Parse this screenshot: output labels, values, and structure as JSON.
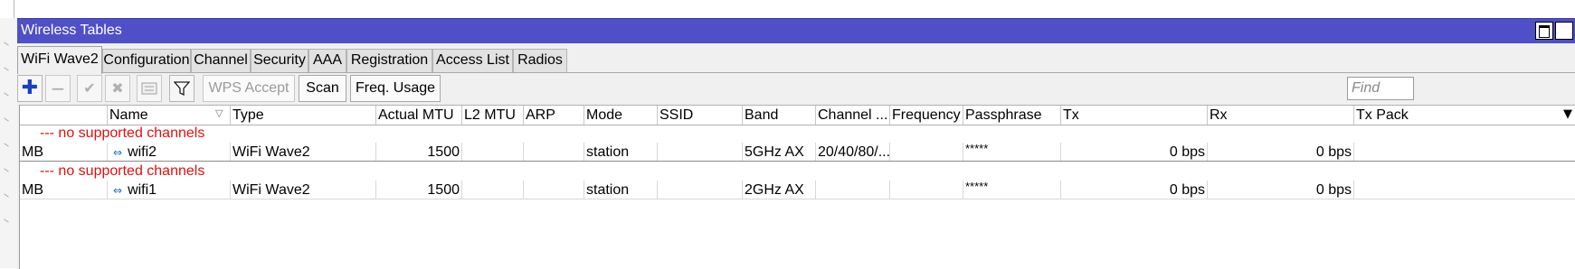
{
  "window": {
    "title": "Wireless Tables",
    "maximize_icon": "maximize-icon",
    "close_icon": "close-icon",
    "close_glyph": "✕"
  },
  "tabs": [
    "WiFi Wave2",
    "Configuration",
    "Channel",
    "Security",
    "AAA",
    "Registration",
    "Access List",
    "Radios"
  ],
  "active_tab": "WiFi Wave2",
  "toolbar": {
    "icons": [
      "add-icon",
      "remove-icon",
      "enable-icon",
      "disable-icon",
      "comment-icon",
      "filter-icon"
    ],
    "wps_accept": "WPS Accept",
    "scan": "Scan",
    "freq_usage": "Freq. Usage",
    "find_placeholder": "Find"
  },
  "table": {
    "columns": [
      "",
      "Name",
      "Type",
      "Actual MTU",
      "L2 MTU",
      "ARP",
      "Mode",
      "SSID",
      "Band",
      "Channel ...",
      "Frequency",
      "Passphrase",
      "Tx",
      "Rx",
      "Tx Pack"
    ],
    "groups": [
      {
        "comment": "--- no supported channels",
        "row": {
          "flags": "MB",
          "name": "wifi2",
          "type": "WiFi Wave2",
          "actual_mtu": "1500",
          "l2_mtu": "",
          "arp": "",
          "mode": "station",
          "ssid": "",
          "band": "5GHz AX",
          "channel": "20/40/80/...",
          "frequency": "",
          "passphrase": "*****",
          "tx": "0 bps",
          "rx": "0 bps",
          "tx_pack": ""
        }
      },
      {
        "comment": "--- no supported channels",
        "row": {
          "flags": "MB",
          "name": "wifi1",
          "type": "WiFi Wave2",
          "actual_mtu": "1500",
          "l2_mtu": "",
          "arp": "",
          "mode": "station",
          "ssid": "",
          "band": "2GHz AX",
          "channel": "",
          "frequency": "",
          "passphrase": "*****",
          "tx": "0 bps",
          "rx": "0 bps",
          "tx_pack": ""
        }
      }
    ]
  },
  "colors": {
    "titlebar": "#4f4fc7",
    "comment_text": "#e01010",
    "interface_icon": "#1a6cc4",
    "add_icon": "#1a3fbf"
  }
}
